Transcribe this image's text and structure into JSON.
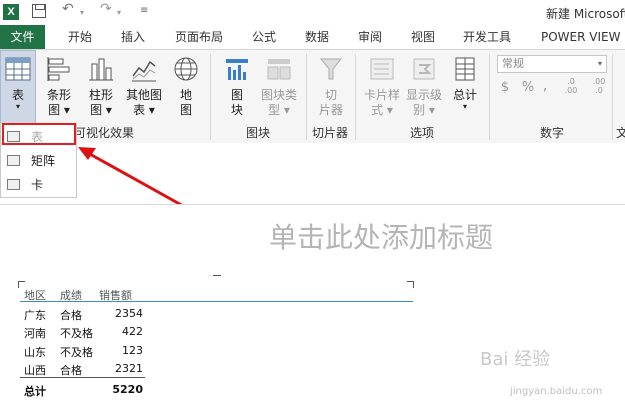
{
  "titlebar": {
    "app_icon": "X",
    "window_title": "新建 Microsoft"
  },
  "tabs": {
    "file": "文件",
    "home": "开始",
    "insert": "插入",
    "page_layout": "页面布局",
    "formulas": "公式",
    "data": "数据",
    "review": "审阅",
    "view": "视图",
    "developer": "开发工具",
    "power_view": "POWER VIEW"
  },
  "ribbon": {
    "table_btn": "表",
    "bar_btn": [
      "条形",
      "图"
    ],
    "column_btn": [
      "柱形",
      "图"
    ],
    "other_chart_btn": [
      "其他图",
      "表"
    ],
    "map_btn": [
      "地",
      "图"
    ],
    "tile_btn": [
      "图",
      "块"
    ],
    "tile_type_btn": [
      "图块类",
      "型"
    ],
    "slicer_btn": [
      "切",
      "片器"
    ],
    "card_style_btn": [
      "卡片样",
      "式"
    ],
    "display_level_btn": [
      "显示级",
      "别"
    ],
    "total_btn": "总计",
    "number_format": "常规",
    "percent": "%",
    "comma": ",",
    "dec_inc": ".0\n.00",
    "dec_dec": ".00\n.0",
    "groups": {
      "visualization": "换可视化效果",
      "tiles": "图块",
      "slicer": "切片器",
      "options": "选项",
      "number": "数字",
      "cut": "文"
    }
  },
  "dropdown": {
    "items": [
      {
        "label": "表",
        "disabled": true
      },
      {
        "label": "矩阵",
        "disabled": false
      },
      {
        "label": "卡",
        "disabled": false
      }
    ]
  },
  "canvas": {
    "title_placeholder": "单击此处添加标题",
    "table": {
      "headers": [
        "地区",
        "成绩",
        "销售额"
      ],
      "rows": [
        [
          "广东",
          "合格",
          "2354"
        ],
        [
          "河南",
          "不及格",
          "422"
        ],
        [
          "山东",
          "不及格",
          "123"
        ],
        [
          "山西",
          "合格",
          "2321"
        ]
      ],
      "total_label": "总计",
      "total_value": "5220"
    }
  },
  "watermark": {
    "text": "Bai 经验",
    "url": "jingyan.baidu.com"
  },
  "colors": {
    "excel_green": "#217346",
    "highlight_red": "#e02020",
    "table_rule": "#3d8fb8"
  }
}
